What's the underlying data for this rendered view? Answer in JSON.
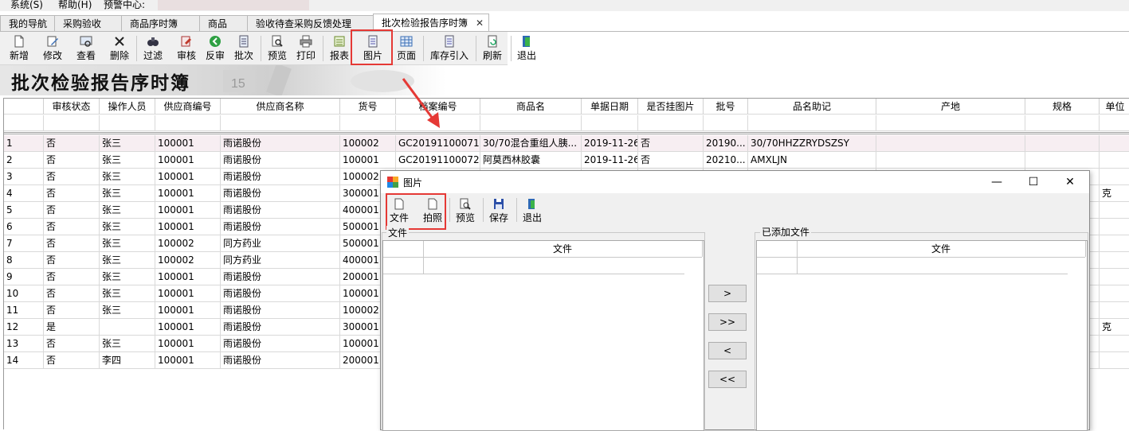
{
  "menu": {
    "system": "系统(S)",
    "help": "帮助(H)",
    "alert": "预警中心:"
  },
  "tabs": [
    {
      "label": "我的导航"
    },
    {
      "label": "采购验收"
    },
    {
      "label": "商品序时簿"
    },
    {
      "label": "商品"
    },
    {
      "label": "验收待查采购反馈处理"
    },
    {
      "label": "批次检验报告序时簿",
      "close": "✕"
    }
  ],
  "toolbar": [
    {
      "label": "新增",
      "icon": "new-doc-icon"
    },
    {
      "label": "修改",
      "icon": "edit-icon"
    },
    {
      "label": "查看",
      "icon": "view-icon"
    },
    {
      "label": "删除",
      "icon": "delete-icon"
    },
    {
      "label": "过滤",
      "icon": "filter-icon"
    },
    {
      "label": "审核",
      "icon": "audit-icon"
    },
    {
      "label": "反审",
      "icon": "unaudit-icon"
    },
    {
      "label": "批次",
      "icon": "batch-icon"
    },
    {
      "label": "预览",
      "icon": "preview-icon"
    },
    {
      "label": "打印",
      "icon": "print-icon"
    },
    {
      "label": "报表",
      "icon": "report-icon"
    },
    {
      "label": "图片",
      "icon": "picture-icon"
    },
    {
      "label": "页面",
      "icon": "page-icon"
    },
    {
      "label": "库存引入",
      "icon": "import-icon"
    },
    {
      "label": "刷新",
      "icon": "refresh-icon"
    },
    {
      "label": "退出",
      "icon": "exit-icon"
    }
  ],
  "banner": {
    "title": "批次检验报告序时簿"
  },
  "grid": {
    "columns": [
      "",
      "审核状态",
      "操作人员",
      "供应商编号",
      "供应商名称",
      "货号",
      "档案编号",
      "商品名",
      "单据日期",
      "是否挂图片",
      "批号",
      "品名助记",
      "产地",
      "规格",
      "单位"
    ],
    "rows": [
      [
        "1",
        "否",
        "张三",
        "100001",
        "雨诺股份",
        "100002",
        "GC20191100071",
        "30/70混合重组人胰...",
        "2019-11-26",
        "否",
        "20190...",
        "30/70HHZZRYDSZSY",
        "",
        "",
        ""
      ],
      [
        "2",
        "否",
        "张三",
        "100001",
        "雨诺股份",
        "100001",
        "GC20191100072",
        "阿莫西林胶囊",
        "2019-11-26",
        "否",
        "20210...",
        "AMXLJN",
        "",
        "",
        ""
      ],
      [
        "3",
        "否",
        "张三",
        "100001",
        "雨诺股份",
        "100002",
        "",
        "",
        "",
        "",
        "",
        "",
        "",
        "",
        ""
      ],
      [
        "4",
        "否",
        "张三",
        "100001",
        "雨诺股份",
        "300001",
        "",
        "",
        "",
        "",
        "",
        "",
        "",
        "",
        "克"
      ],
      [
        "5",
        "否",
        "张三",
        "100001",
        "雨诺股份",
        "400001",
        "",
        "",
        "",
        "",
        "",
        "",
        "",
        "",
        ""
      ],
      [
        "6",
        "否",
        "张三",
        "100001",
        "雨诺股份",
        "500001",
        "",
        "",
        "",
        "",
        "",
        "",
        "",
        "",
        ""
      ],
      [
        "7",
        "否",
        "张三",
        "100002",
        "同方药业",
        "500001",
        "",
        "",
        "",
        "",
        "",
        "",
        "",
        "",
        ""
      ],
      [
        "8",
        "否",
        "张三",
        "100002",
        "同方药业",
        "400001",
        "",
        "",
        "",
        "",
        "",
        "",
        "",
        "",
        ""
      ],
      [
        "9",
        "否",
        "张三",
        "100001",
        "雨诺股份",
        "200001",
        "",
        "",
        "",
        "",
        "",
        "",
        "",
        "",
        ""
      ],
      [
        "10",
        "否",
        "张三",
        "100001",
        "雨诺股份",
        "100001",
        "",
        "",
        "",
        "",
        "",
        "",
        "",
        "",
        ""
      ],
      [
        "11",
        "否",
        "张三",
        "100001",
        "雨诺股份",
        "100002",
        "",
        "",
        "",
        "",
        "",
        "",
        "",
        "",
        ""
      ],
      [
        "12",
        "是",
        "",
        "100001",
        "雨诺股份",
        "300001",
        "",
        "",
        "",
        "",
        "",
        "",
        "",
        "",
        "克"
      ],
      [
        "13",
        "否",
        "张三",
        "100001",
        "雨诺股份",
        "100001",
        "",
        "",
        "",
        "",
        "",
        "",
        "",
        "",
        ""
      ],
      [
        "14",
        "否",
        "李四",
        "100001",
        "雨诺股份",
        "200001",
        "",
        "",
        "",
        "",
        "",
        "",
        "",
        "",
        ""
      ]
    ]
  },
  "dialog": {
    "title": "图片",
    "toolbar": [
      {
        "label": "文件",
        "icon": "file-icon"
      },
      {
        "label": "拍照",
        "icon": "camera-icon"
      },
      {
        "label": "预览",
        "icon": "preview-icon"
      },
      {
        "label": "保存",
        "icon": "save-icon"
      },
      {
        "label": "退出",
        "icon": "exit-icon"
      }
    ],
    "left_group": "文件",
    "right_group": "已添加文件",
    "left_col": "文件",
    "right_col": "文件",
    "buttons": [
      ">",
      ">>",
      "<",
      "<<"
    ]
  }
}
